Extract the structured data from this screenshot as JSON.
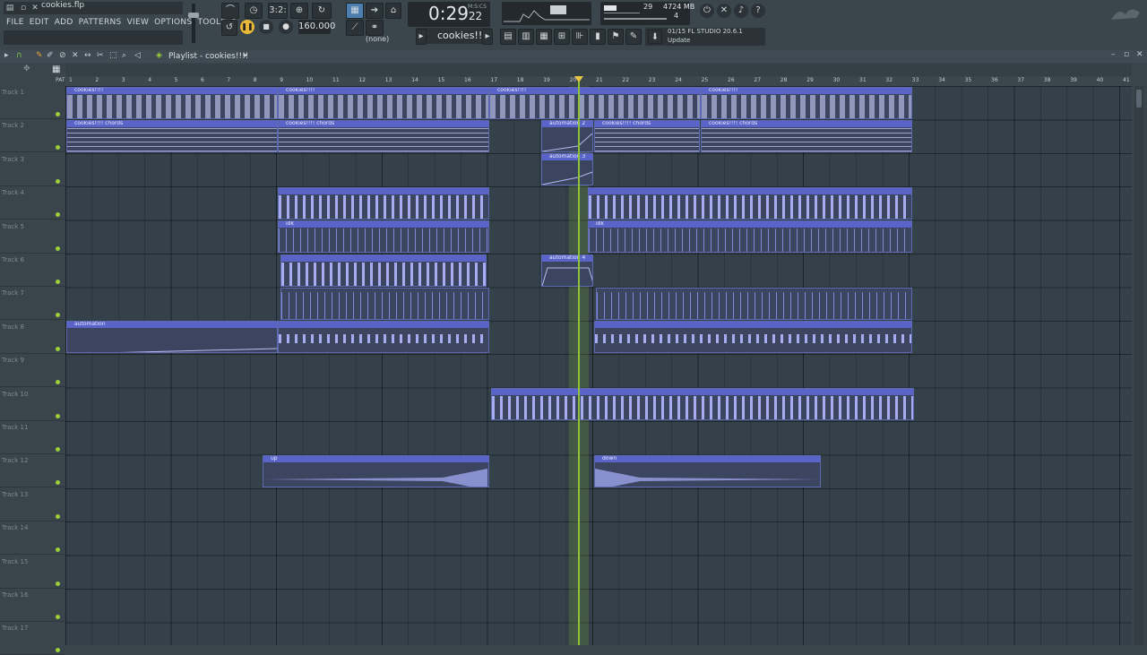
{
  "window": {
    "filename": "cookies.flp",
    "menu": [
      "FILE",
      "EDIT",
      "ADD",
      "PATTERNS",
      "VIEW",
      "OPTIONS",
      "TOOLS",
      "?"
    ]
  },
  "transport": {
    "bars_beats": "3:2:",
    "tempo": "160.000",
    "time": "0:29",
    "time_frac": "22",
    "time_unit": "M:S:CS",
    "cpu": "29",
    "memory": "4724 MB",
    "voices": "4",
    "pattern": "cookies!!!!",
    "channel_none": "(none)",
    "news_line1": "01/15  FL STUDIO 20.6.1",
    "news_line2": "Update"
  },
  "playlist": {
    "title": "Playlist - cookies!!!!",
    "ruler": [
      "1",
      "2",
      "3",
      "4",
      "5",
      "6",
      "7",
      "8",
      "9",
      "10",
      "11",
      "12",
      "13",
      "14",
      "15",
      "16",
      "17",
      "18",
      "19",
      "20",
      "21",
      "22",
      "23",
      "24",
      "25",
      "26",
      "27",
      "28",
      "29",
      "30",
      "31",
      "32",
      "33",
      "34",
      "35",
      "36",
      "37",
      "38",
      "39",
      "40",
      "41"
    ],
    "tracks": [
      "Track 1",
      "Track 2",
      "Track 3",
      "Track 4",
      "Track 5",
      "Track 6",
      "Track 7",
      "Track 8",
      "Track 9",
      "Track 10",
      "Track 11",
      "Track 12",
      "Track 13",
      "Track 14",
      "Track 15",
      "Track 16",
      "Track 17"
    ],
    "clips": {
      "cookies": "cookies!!!!",
      "chords": "cookies!!!! chords",
      "automation": "automation",
      "automation2": "automation 2",
      "automation3": "automation 3",
      "automation4": "automation 4",
      "idk": "idk",
      "up": "up",
      "down": "down"
    }
  },
  "colors": {
    "accent": "#5a63c8",
    "playhead": "#8ec237",
    "play_button": "#e9b838",
    "background": "#34414a"
  }
}
